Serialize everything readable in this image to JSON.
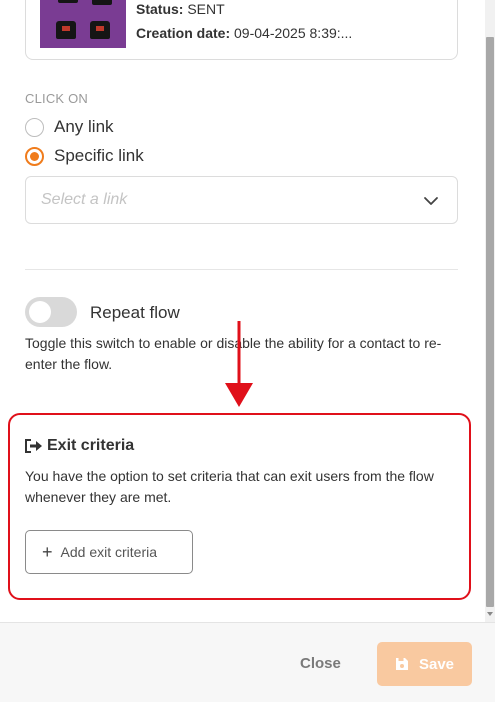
{
  "campaign": {
    "status_label": "Status:",
    "status_value": "SENT",
    "date_label": "Creation date:",
    "date_value": "09-04-2025 8:39:..."
  },
  "click_on": {
    "label": "CLICK ON",
    "options": [
      {
        "label": "Any link",
        "selected": false
      },
      {
        "label": "Specific link",
        "selected": true
      }
    ],
    "link_select": {
      "placeholder": "Select a link"
    }
  },
  "repeat_flow": {
    "label": "Repeat flow",
    "enabled": false,
    "description": "Toggle this switch to enable or disable the ability for a contact to re-enter the flow."
  },
  "exit_criteria": {
    "title": "Exit criteria",
    "description": "You have the option to set criteria that can exit users from the flow whenever they are met.",
    "add_button_label": "Add exit criteria"
  },
  "footer": {
    "close_label": "Close",
    "save_label": "Save"
  },
  "colors": {
    "accent": "#f07c1c",
    "highlight_border": "#e0101a",
    "arrow": "#e0101a",
    "save_disabled": "#f9c9a0"
  },
  "icons": {
    "exit": "exit-icon",
    "plus": "plus-icon",
    "save": "save-icon",
    "chevron": "chevron-down-icon"
  }
}
